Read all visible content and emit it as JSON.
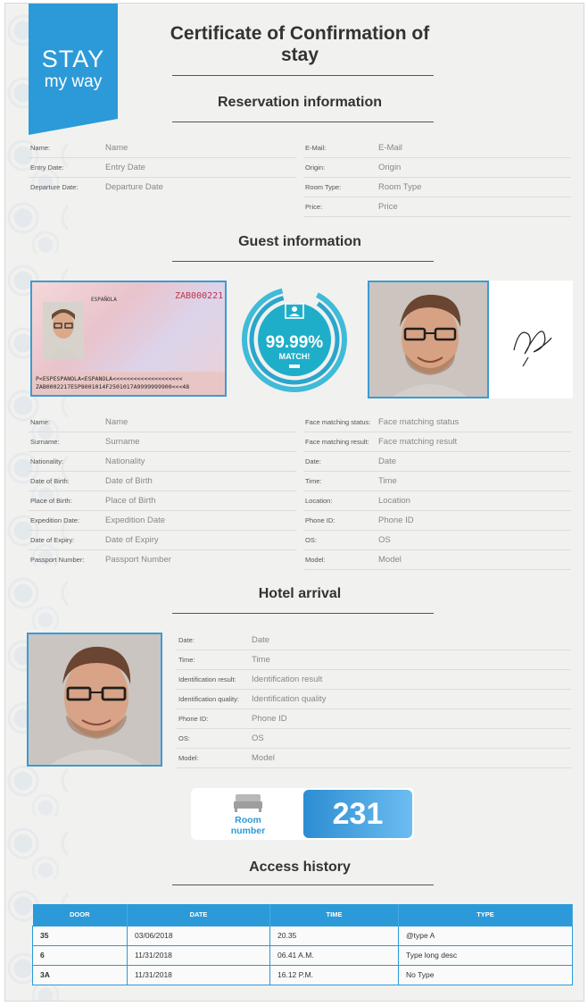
{
  "logo": {
    "line1": "STAY",
    "line2": "my way"
  },
  "title": "Certificate of Confirmation of stay",
  "reservation": {
    "title": "Reservation information",
    "left": [
      {
        "label": "Name:",
        "value": "Name"
      },
      {
        "label": "Entry Date:",
        "value": "Entry Date"
      },
      {
        "label": "Departure Date:",
        "value": "Departure Date"
      }
    ],
    "right": [
      {
        "label": "E-Mail:",
        "value": "E-Mail"
      },
      {
        "label": "Origin:",
        "value": "Origin"
      },
      {
        "label": "Room Type:",
        "value": "Room Type"
      },
      {
        "label": "Price:",
        "value": "Price"
      }
    ]
  },
  "guest": {
    "title": "Guest information",
    "id_card": {
      "number": "ZAB000221",
      "country": "ESPAÑOLA",
      "mrz1": "P<ESPESPANOLA<ESPANOLA<<<<<<<<<<<<<<<<<<<<",
      "mrz2": "ZAB0002217ESP8001014F2501017A9999999900<<<48"
    },
    "match": {
      "percent": "99.99%",
      "label": "MATCH!"
    },
    "left": [
      {
        "label": "Name:",
        "value": "Name"
      },
      {
        "label": "Surname:",
        "value": "Surname"
      },
      {
        "label": "Nationality:",
        "value": "Nationality"
      },
      {
        "label": "Date of Birth:",
        "value": "Date of Birth"
      },
      {
        "label": "Place of Birth:",
        "value": "Place of Birth"
      },
      {
        "label": "Expedition Date:",
        "value": "Expedition Date"
      },
      {
        "label": "Date of Expiry:",
        "value": "Date of Expiry"
      },
      {
        "label": "Passport Number:",
        "value": "Passport Number"
      }
    ],
    "right": [
      {
        "label": "Face matching status:",
        "value": "Face matching status"
      },
      {
        "label": "Face matching result:",
        "value": "Face matching result"
      },
      {
        "label": "Date:",
        "value": "Date"
      },
      {
        "label": "Time:",
        "value": "Time"
      },
      {
        "label": "Location:",
        "value": "Location"
      },
      {
        "label": "Phone ID:",
        "value": "Phone ID"
      },
      {
        "label": "OS:",
        "value": "OS"
      },
      {
        "label": "Model:",
        "value": "Model"
      }
    ]
  },
  "arrival": {
    "title": "Hotel arrival",
    "fields": [
      {
        "label": "Date:",
        "value": "Date"
      },
      {
        "label": "Time:",
        "value": "Time"
      },
      {
        "label": "Identification result:",
        "value": "Identification result"
      },
      {
        "label": "Identification quality:",
        "value": "Identification quality"
      },
      {
        "label": "Phone ID:",
        "value": "Phone ID"
      },
      {
        "label": "OS:",
        "value": "OS"
      },
      {
        "label": "Model:",
        "value": "Model"
      }
    ]
  },
  "room": {
    "label_line1": "Room",
    "label_line2": "number",
    "number": "231"
  },
  "history": {
    "title": "Access history",
    "headers": [
      "DOOR",
      "DATE",
      "TIME",
      "TYPE"
    ],
    "rows": [
      [
        "35",
        "03/06/2018",
        "20.35",
        "@type A"
      ],
      [
        "6",
        "11/31/2018",
        "06.41 A.M.",
        "Type long desc"
      ],
      [
        "3A",
        "11/31/2018",
        "16.12 P.M.",
        "No Type"
      ]
    ]
  },
  "colors": {
    "accent": "#2c9ad8",
    "background": "#f1f1ef",
    "text": "#333333"
  }
}
